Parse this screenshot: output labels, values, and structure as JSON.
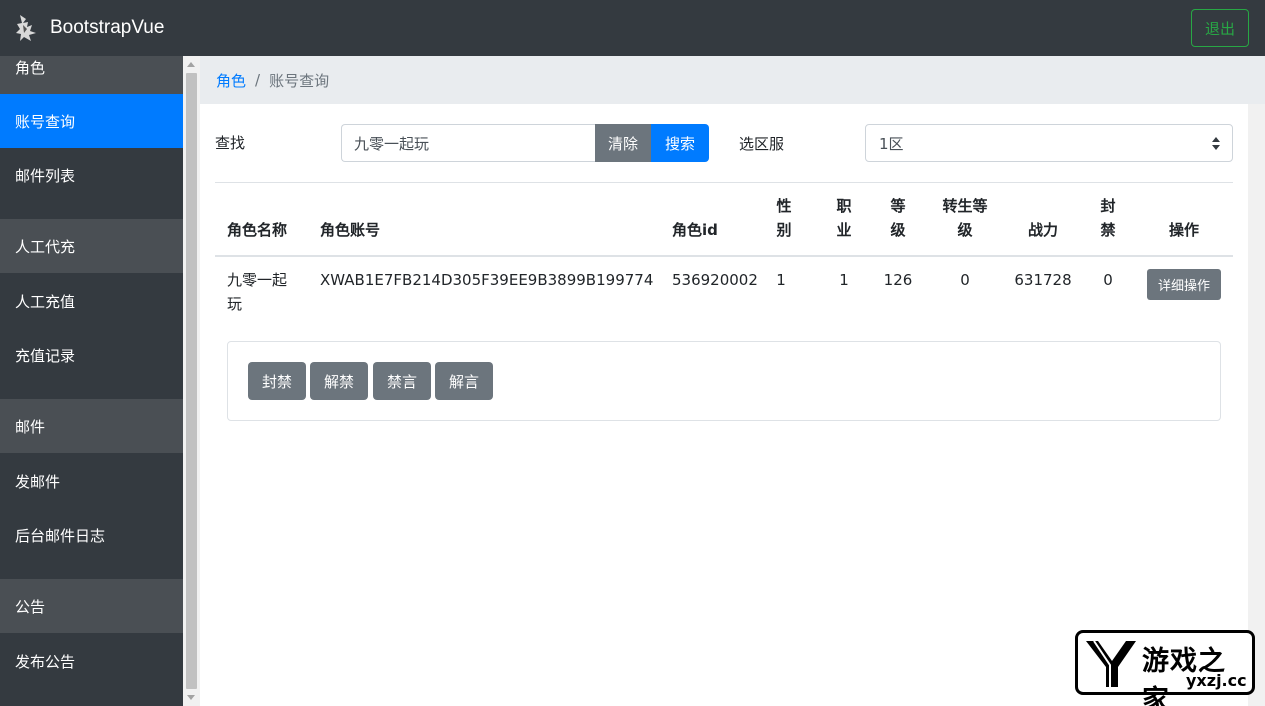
{
  "navbar": {
    "brand": "BootstrapVue",
    "logout_label": "退出"
  },
  "sidebar": {
    "items": [
      {
        "label": "角色",
        "type": "header"
      },
      {
        "label": "账号查询",
        "type": "active"
      },
      {
        "label": "邮件列表",
        "type": "item"
      },
      {
        "label": "人工代充",
        "type": "header"
      },
      {
        "label": "人工充值",
        "type": "item"
      },
      {
        "label": "充值记录",
        "type": "item"
      },
      {
        "label": "邮件",
        "type": "header"
      },
      {
        "label": "发邮件",
        "type": "item"
      },
      {
        "label": "后台邮件日志",
        "type": "item"
      },
      {
        "label": "公告",
        "type": "header"
      },
      {
        "label": "发布公告",
        "type": "item"
      }
    ]
  },
  "breadcrumb": {
    "parent": "角色",
    "separator": "/",
    "current": "账号查询"
  },
  "search": {
    "label": "查找",
    "value": "九零一起玩",
    "clear_label": "清除",
    "search_label": "搜索",
    "server_label": "选区服",
    "server_selected": "1区"
  },
  "table": {
    "headers": {
      "role_name": "角色名称",
      "account": "角色账号",
      "role_id": "角色id",
      "gender": [
        "性",
        "别"
      ],
      "job": [
        "职",
        "业"
      ],
      "level": [
        "等",
        "级"
      ],
      "rebirth": [
        "转生等",
        "级"
      ],
      "power": "战力",
      "banned": [
        "封",
        "禁"
      ],
      "action": "操作"
    },
    "rows": [
      {
        "role_name": [
          "九零一起",
          "玩"
        ],
        "account": "XWAB1E7FB214D305F39EE9B3899B199774",
        "role_id": "536920002",
        "gender": "1",
        "job": "1",
        "level": "126",
        "rebirth": "0",
        "power": "631728",
        "banned": "0",
        "action_label": "详细操作"
      }
    ]
  },
  "actions": {
    "ban": "封禁",
    "unban": "解禁",
    "mute": "禁言",
    "unmute": "解言"
  },
  "watermark": {
    "name": "游戏之家",
    "url": "yxzj.cc"
  },
  "colors": {
    "primary": "#007bff",
    "secondary": "#6c757d",
    "dark": "#343a40",
    "success": "#28a745"
  }
}
